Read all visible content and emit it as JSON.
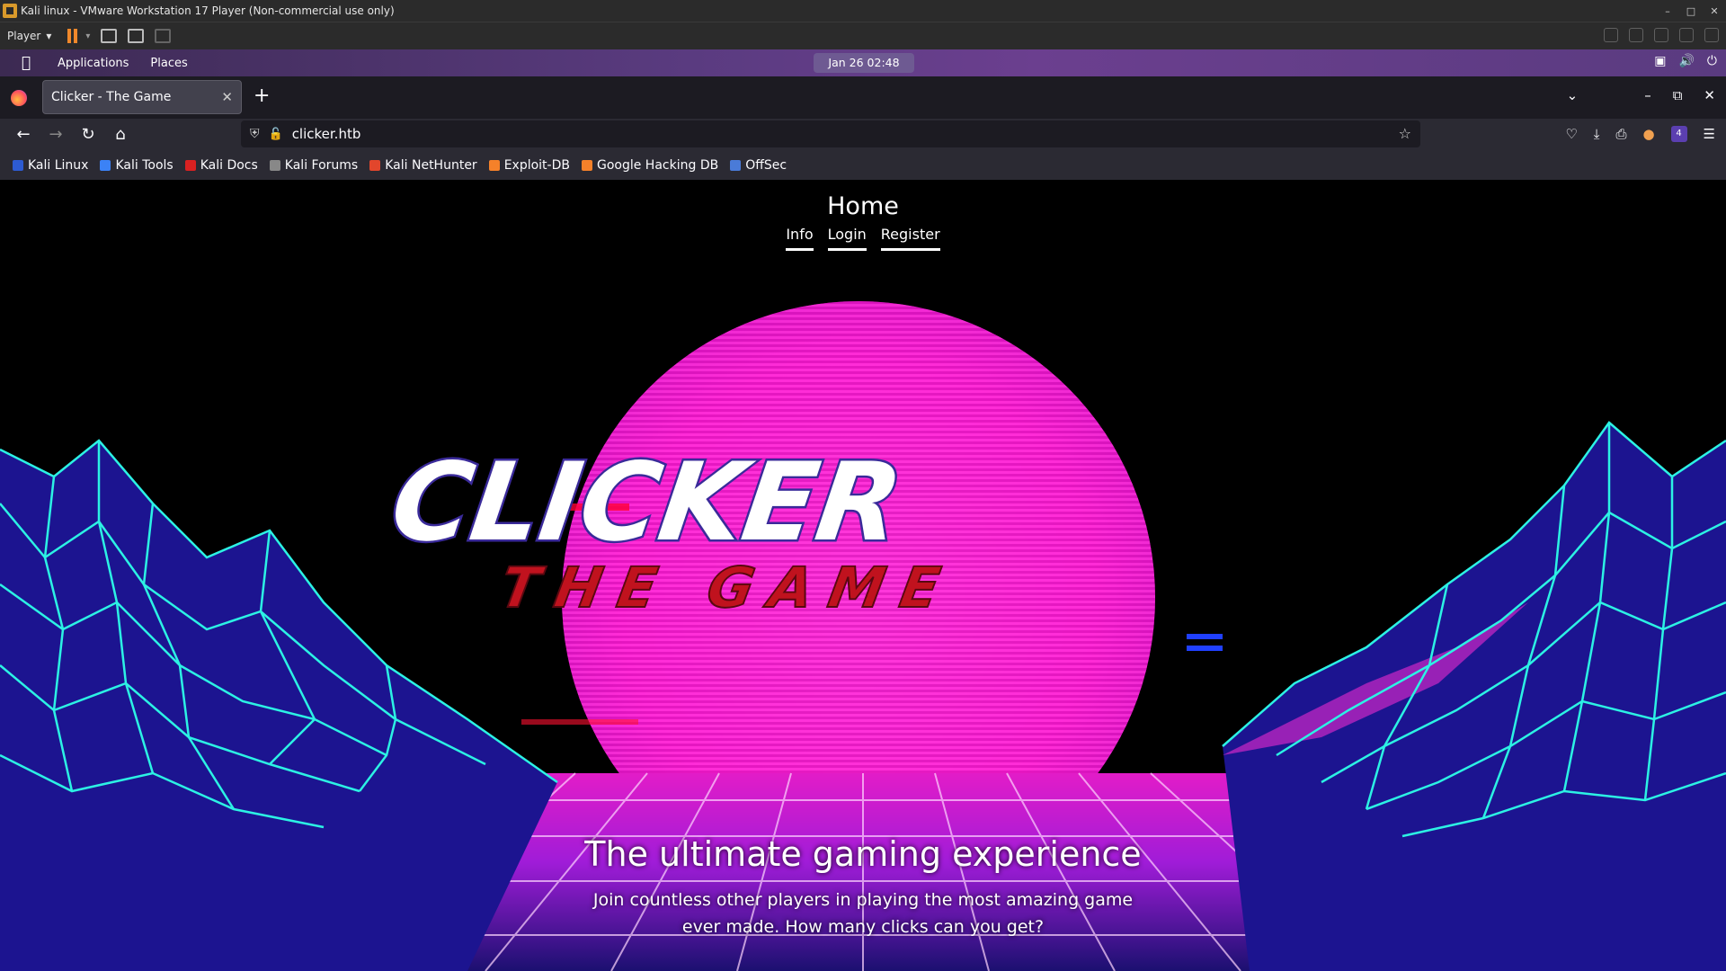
{
  "vmware": {
    "title": "Kali linux - VMware Workstation 17 Player (Non-commercial use only)",
    "player_menu": "Player"
  },
  "panel": {
    "applications": "Applications",
    "places": "Places",
    "clock": "Jan 26  02:48"
  },
  "browser": {
    "tab_title": "Clicker - The Game",
    "url": "clicker.htb",
    "extension_badge": "4",
    "bookmarks": [
      {
        "label": "Kali Linux",
        "color": "#2d5bd2"
      },
      {
        "label": "Kali Tools",
        "color": "#3b82f6"
      },
      {
        "label": "Kali Docs",
        "color": "#d92121"
      },
      {
        "label": "Kali Forums",
        "color": "#888888"
      },
      {
        "label": "Kali NetHunter",
        "color": "#e2462c"
      },
      {
        "label": "Exploit-DB",
        "color": "#f5812a"
      },
      {
        "label": "Google Hacking DB",
        "color": "#f5812a"
      },
      {
        "label": "OffSec",
        "color": "#4a7bd8"
      }
    ]
  },
  "site": {
    "heading": "Home",
    "nav": [
      "Info",
      "Login",
      "Register"
    ],
    "logo_title": "CLICKER",
    "logo_subtitle": "THE GAME",
    "tagline": "The ultimate gaming experience",
    "description": "Join countless other players in playing the most amazing game ever made. How many clicks can you get?"
  },
  "colors": {
    "sun": "#ff2bd6",
    "grid": "#2cf2e4",
    "mountain_shade": "#2a1d8f",
    "logo_red": "#c0121e",
    "panel_purple": "#5a3b80"
  }
}
